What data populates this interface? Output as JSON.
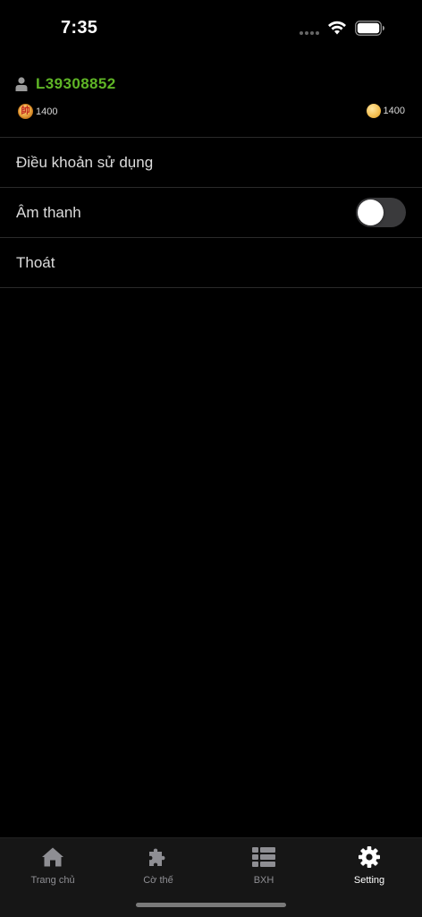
{
  "status_bar": {
    "time": "7:35"
  },
  "profile": {
    "username": "L39308852",
    "rating": "1400",
    "coins": "1400",
    "username_color": "#5fb526"
  },
  "menu": {
    "items": [
      {
        "label": "Điều khoản sử dụng"
      },
      {
        "label": "Âm thanh"
      },
      {
        "label": "Thoát"
      }
    ],
    "sound_enabled": false
  },
  "tab_bar": {
    "tabs": [
      {
        "label": "Trang chủ",
        "icon": "home-icon",
        "active": false
      },
      {
        "label": "Cờ thế",
        "icon": "puzzle-icon",
        "active": false
      },
      {
        "label": "BXH",
        "icon": "list-icon",
        "active": false
      },
      {
        "label": "Setting",
        "icon": "gear-icon",
        "active": true
      }
    ]
  }
}
